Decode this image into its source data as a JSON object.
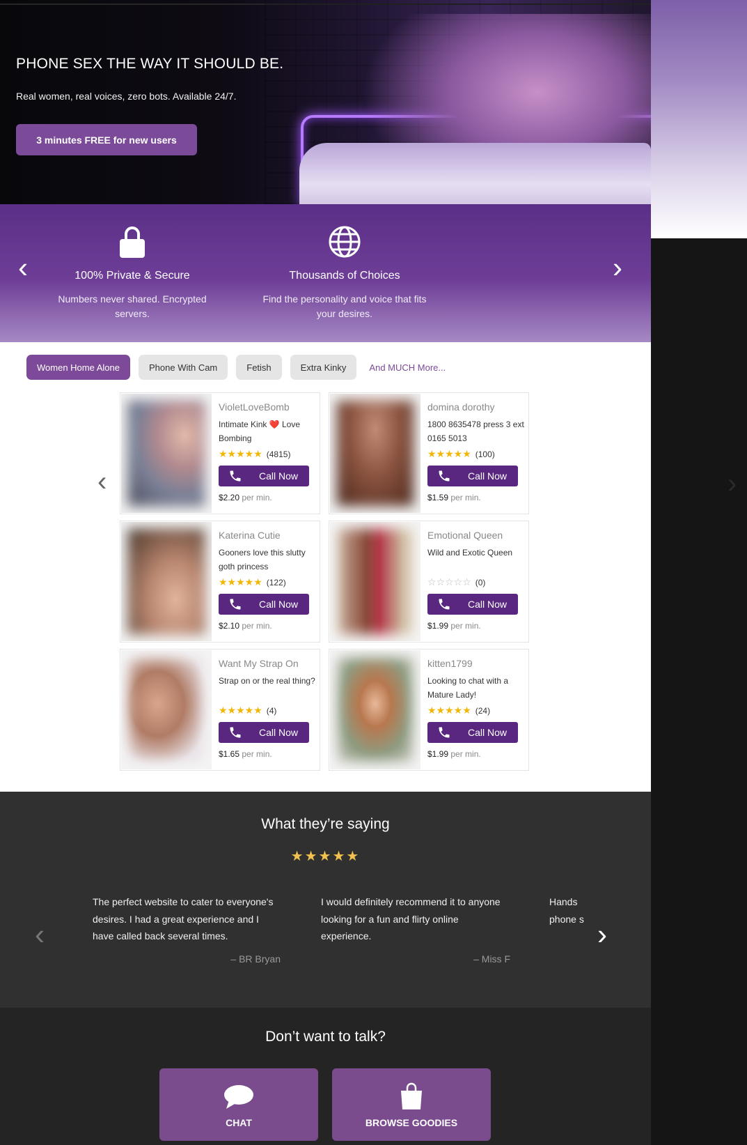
{
  "hero": {
    "title": "PHONE SEX THE WAY IT SHOULD BE.",
    "subtitle": "Real women, real voices, zero bots. Available 24/7.",
    "cta_label": "3 minutes FREE for new users"
  },
  "features": {
    "items": [
      {
        "icon": "lock-icon",
        "title": "100% Private & Secure",
        "desc": "Numbers never shared. Encrypted servers."
      },
      {
        "icon": "globe-icon",
        "title": "Thousands of Choices",
        "desc": "Find the personality and voice that fits your desires."
      }
    ]
  },
  "tabs": [
    {
      "label": "Women Home Alone",
      "active": true
    },
    {
      "label": "Phone With Cam",
      "active": false
    },
    {
      "label": "Fetish",
      "active": false
    },
    {
      "label": "Extra Kinky",
      "active": false
    },
    {
      "label": "And MUCH More...",
      "active": false
    }
  ],
  "listings": [
    {
      "name": "VioletLoveBomb",
      "desc": "Intimate Kink ❤️ Love Bombing",
      "stars": "★★★★★",
      "reviews": "(4815)",
      "call_label": "Call Now",
      "price": "$2.20",
      "unit": "per min."
    },
    {
      "name": "domina dorothy",
      "desc": "1800 8635478 press 3 ext 0165 5013",
      "stars": "★★★★★",
      "reviews": "(100)",
      "call_label": "Call Now",
      "price": "$1.59",
      "unit": "per min."
    },
    {
      "name": "Katerina Cutie",
      "desc": "Gooners love this slutty goth princess",
      "stars": "★★★★★",
      "reviews": "(122)",
      "call_label": "Call Now",
      "price": "$2.10",
      "unit": "per min."
    },
    {
      "name": "Emotional Queen",
      "desc": "Wild and Exotic Queen",
      "stars": "☆☆☆☆☆",
      "reviews": "(0)",
      "call_label": "Call Now",
      "price": "$1.99",
      "unit": "per min."
    },
    {
      "name": "Want My Strap On",
      "desc": "Strap on or the real thing?",
      "stars": "★★★★★",
      "reviews": "(4)",
      "call_label": "Call Now",
      "price": "$1.65",
      "unit": "per min."
    },
    {
      "name": "kitten1799",
      "desc": "Looking to chat with a Mature Lady!",
      "stars": "★★★★★",
      "reviews": "(24)",
      "call_label": "Call Now",
      "price": "$1.99",
      "unit": "per min."
    }
  ],
  "testimonials": {
    "title": "What they’re saying",
    "stars": "★★★★★",
    "quotes": [
      {
        "text": "The perfect website to cater to everyone's desires. I had a great experience and I have called back several times.",
        "author": "– BR Bryan"
      },
      {
        "text": "I would definitely recommend it to anyone looking for a fun and flirty online experience.",
        "author": "– Miss F"
      },
      {
        "text": "Hands phone s",
        "author": ""
      }
    ]
  },
  "bottom": {
    "title": "Don’t want to talk?",
    "chat_label": "CHAT",
    "goodies_label": "BROWSE GOODIES"
  },
  "colors": {
    "accent": "#7c4a98",
    "call_button": "#5a2780",
    "star": "#f2b705"
  }
}
